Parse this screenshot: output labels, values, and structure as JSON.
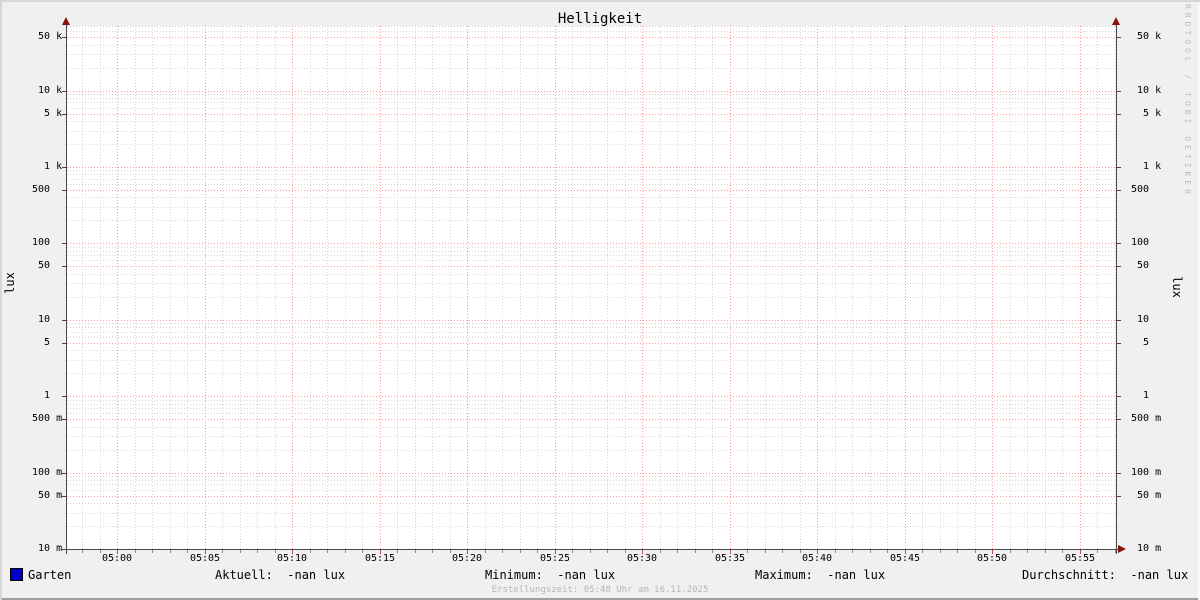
{
  "chart_data": {
    "type": "line",
    "title": "Helligkeit",
    "ylabel": "lux",
    "ylabel_right": "lux",
    "y_scale": "log",
    "ylim": [
      0.01,
      70000
    ],
    "y_major_ticks": [
      {
        "value": 50000,
        "label": " 50 k"
      },
      {
        "value": 10000,
        "label": " 10 k"
      },
      {
        "value": 5000,
        "label": "  5 k"
      },
      {
        "value": 1000,
        "label": "  1 k"
      },
      {
        "value": 500,
        "label": "500  "
      },
      {
        "value": 100,
        "label": "100  "
      },
      {
        "value": 50,
        "label": " 50  "
      },
      {
        "value": 10,
        "label": " 10  "
      },
      {
        "value": 5,
        "label": "  5  "
      },
      {
        "value": 1,
        "label": "  1  "
      },
      {
        "value": 0.5,
        "label": "500 m"
      },
      {
        "value": 0.1,
        "label": "100 m"
      },
      {
        "value": 0.05,
        "label": " 50 m"
      },
      {
        "value": 0.01,
        "label": " 10 m"
      }
    ],
    "y_minor_multiples": [
      2,
      3,
      4,
      6,
      7,
      8,
      9
    ],
    "x_major_ticks": [
      "05:00",
      "05:05",
      "05:10",
      "05:15",
      "05:20",
      "05:25",
      "05:30",
      "05:35",
      "05:40",
      "05:45",
      "05:50",
      "05:55"
    ],
    "x_minutes_per_minor": 1,
    "x_minutes_per_major": 5,
    "grid": true,
    "legend_position": "bottom",
    "series": [
      {
        "name": "Garten",
        "color": "#0000c8",
        "values": [],
        "note": "no data drawn, all values -nan"
      }
    ]
  },
  "footer": {
    "legend_label": "Garten",
    "stats": [
      {
        "id": "aktuell",
        "label": "Aktuell:",
        "value": "-nan lux"
      },
      {
        "id": "minimum",
        "label": "Minimum:",
        "value": "-nan lux"
      },
      {
        "id": "maximum",
        "label": "Maximum:",
        "value": "-nan lux"
      },
      {
        "id": "durchschnitt",
        "label": "Durchschnitt:",
        "value": "-nan lux"
      }
    ],
    "creation_note": "Erstellungszeit: 05:48 Uhr am 16.11.2025"
  },
  "watermark": "RRDTOOL / TOBI OETIKER",
  "colors": {
    "background": "#f0f0f0",
    "canvas": "#ffffff",
    "grid_minor": "#d5d5d5",
    "grid_major": "#ff9797",
    "axis": "#474747",
    "arrow": "#8b1010",
    "series_garten": "#0000c8",
    "watermark_text": "#bcbcbc",
    "fineprint_text": "#b6b6b6"
  }
}
